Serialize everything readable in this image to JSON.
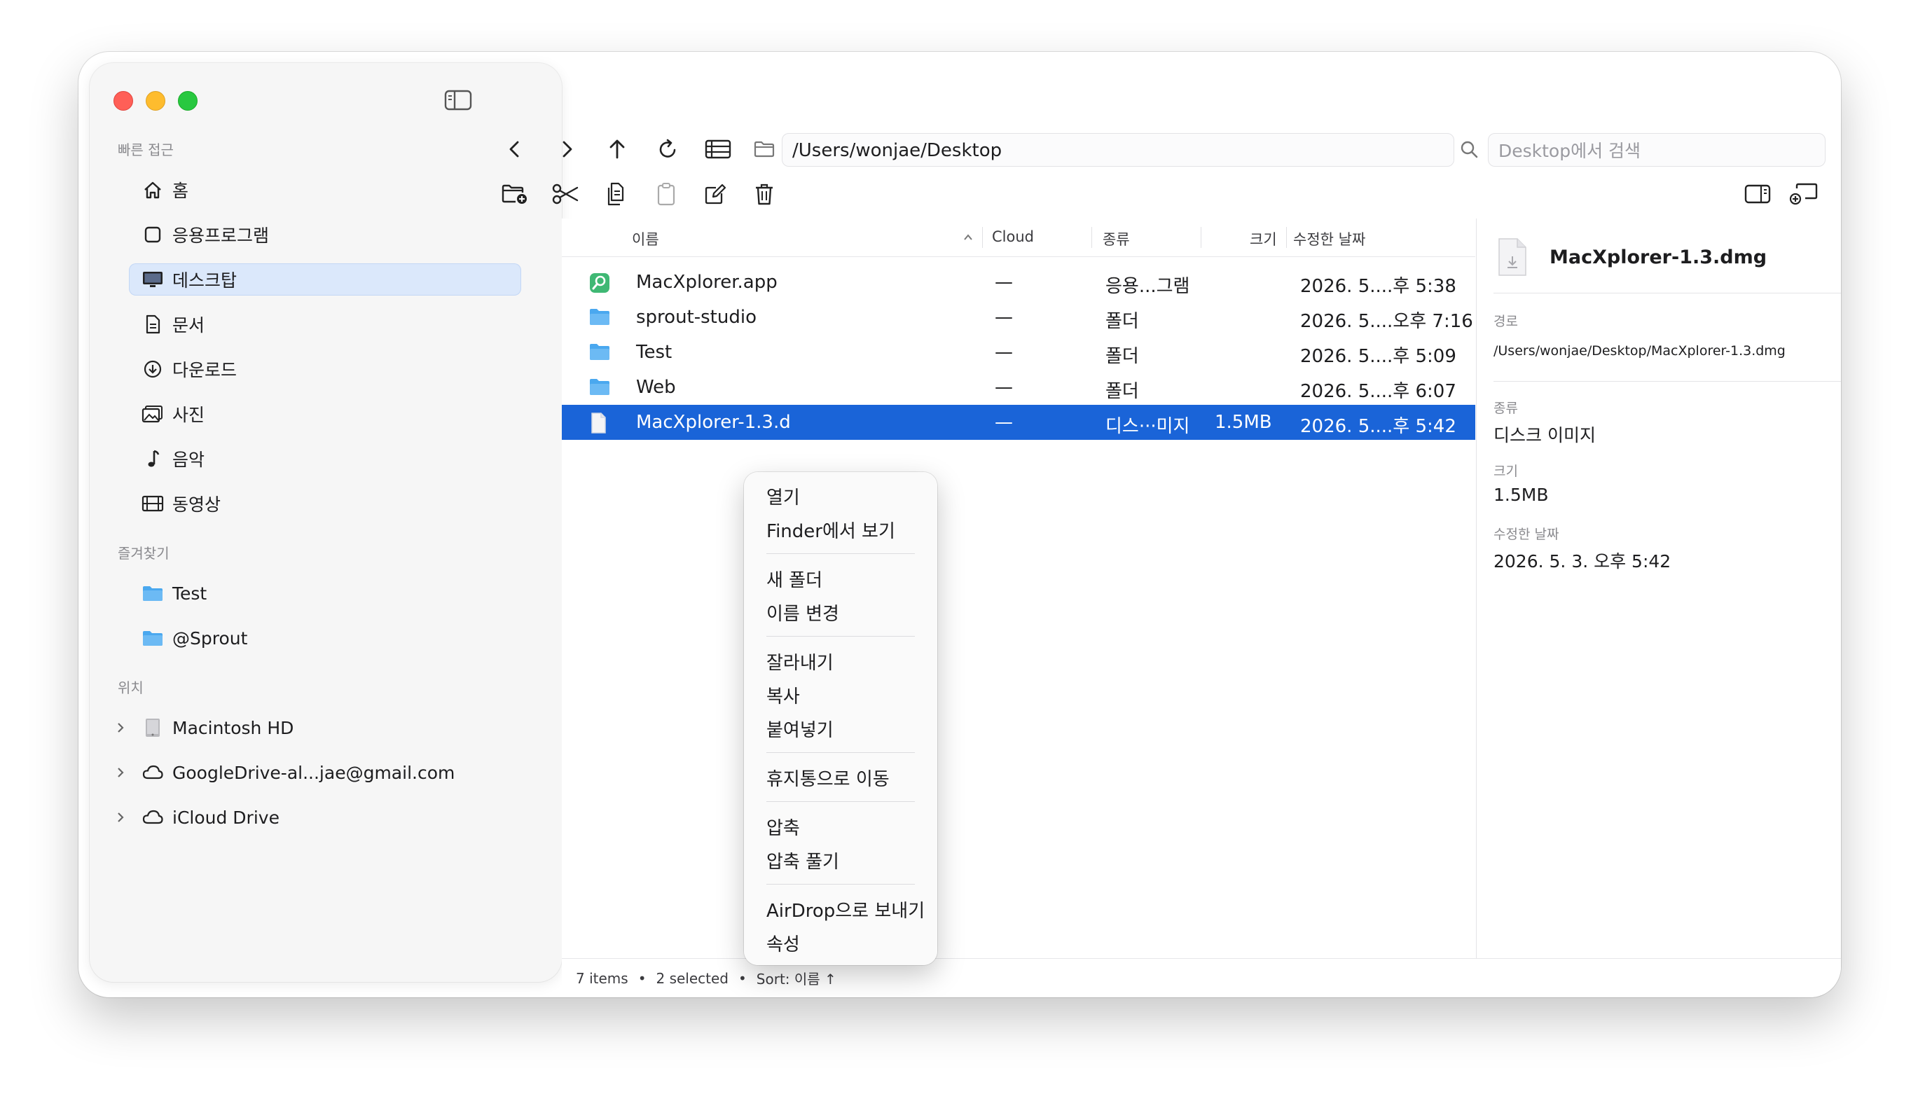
{
  "sidebar": {
    "quick_access_title": "빠른 접근",
    "quick_access": [
      {
        "label": "홈",
        "icon": "house-icon"
      },
      {
        "label": "응용프로그램",
        "icon": "square-icon"
      },
      {
        "label": "데스크탑",
        "icon": "display-icon",
        "selected": true
      },
      {
        "label": "문서",
        "icon": "doc-icon"
      },
      {
        "label": "다운로드",
        "icon": "download-icon"
      },
      {
        "label": "사진",
        "icon": "photo-icon"
      },
      {
        "label": "음악",
        "icon": "music-note-icon"
      },
      {
        "label": "동영상",
        "icon": "film-icon"
      }
    ],
    "favorites_title": "즐겨찾기",
    "favorites": [
      {
        "label": "Test",
        "icon": "folder-icon"
      },
      {
        "label": "@Sprout",
        "icon": "folder-icon"
      }
    ],
    "locations_title": "위치",
    "locations": [
      {
        "label": "Macintosh HD",
        "icon": "drive-icon"
      },
      {
        "label": "GoogleDrive-al...jae@gmail.com",
        "icon": "cloud-icon"
      },
      {
        "label": "iCloud Drive",
        "icon": "cloud-icon"
      }
    ]
  },
  "toolbar": {
    "path": "/Users/wonjae/Desktop",
    "search_placeholder": "Desktop에서 검색"
  },
  "columns": {
    "name": "이름",
    "cloud": "Cloud",
    "kind": "종류",
    "size": "크기",
    "modified": "수정한 날짜"
  },
  "files": [
    {
      "name": "MacXplorer.app",
      "cloud": "—",
      "kind": "응용...그램",
      "size": "",
      "modified": "2026. 5....후 5:38",
      "icon": "app-icon"
    },
    {
      "name": "sprout-studio",
      "cloud": "—",
      "kind": "폴더",
      "size": "",
      "modified": "2026. 5....오후 7:16",
      "icon": "folder-icon"
    },
    {
      "name": "Test",
      "cloud": "—",
      "kind": "폴더",
      "size": "",
      "modified": "2026. 5....후 5:09",
      "icon": "folder-icon"
    },
    {
      "name": "Web",
      "cloud": "—",
      "kind": "폴더",
      "size": "",
      "modified": "2026. 5....후 6:07",
      "icon": "folder-icon"
    },
    {
      "name": "MacXplorer-1.3.d",
      "cloud": "—",
      "kind": "디스···미지",
      "size": "1.5MB",
      "modified": "2026. 5....후 5:42",
      "icon": "dmg-file-icon",
      "selected": true
    }
  ],
  "detail": {
    "title": "MacXplorer-1.3.dmg",
    "path_label": "경로",
    "path_value": "/Users/wonjae/Desktop/MacXplorer-1.3.dmg",
    "kind_label": "종류",
    "kind_value": "디스크 이미지",
    "size_label": "크기",
    "size_value": "1.5MB",
    "modified_label": "수정한 날짜",
    "modified_value": "2026. 5. 3. 오후 5:42"
  },
  "context_menu": [
    "열기",
    "Finder에서 보기",
    "새 폴더",
    "이름 변경",
    "잘라내기",
    "복사",
    "붙여넣기",
    "휴지통으로 이동",
    "압축",
    "압축 풀기",
    "AirDrop으로 보내기",
    "속성"
  ],
  "status": {
    "items": "7 items",
    "selected": "2 selected",
    "sort": "Sort: 이름 ↑"
  },
  "colors": {
    "selection_blue": "#1a64d8",
    "sidebar_selected": "#dbe8fb",
    "folder_blue": "#4aa8ef"
  }
}
